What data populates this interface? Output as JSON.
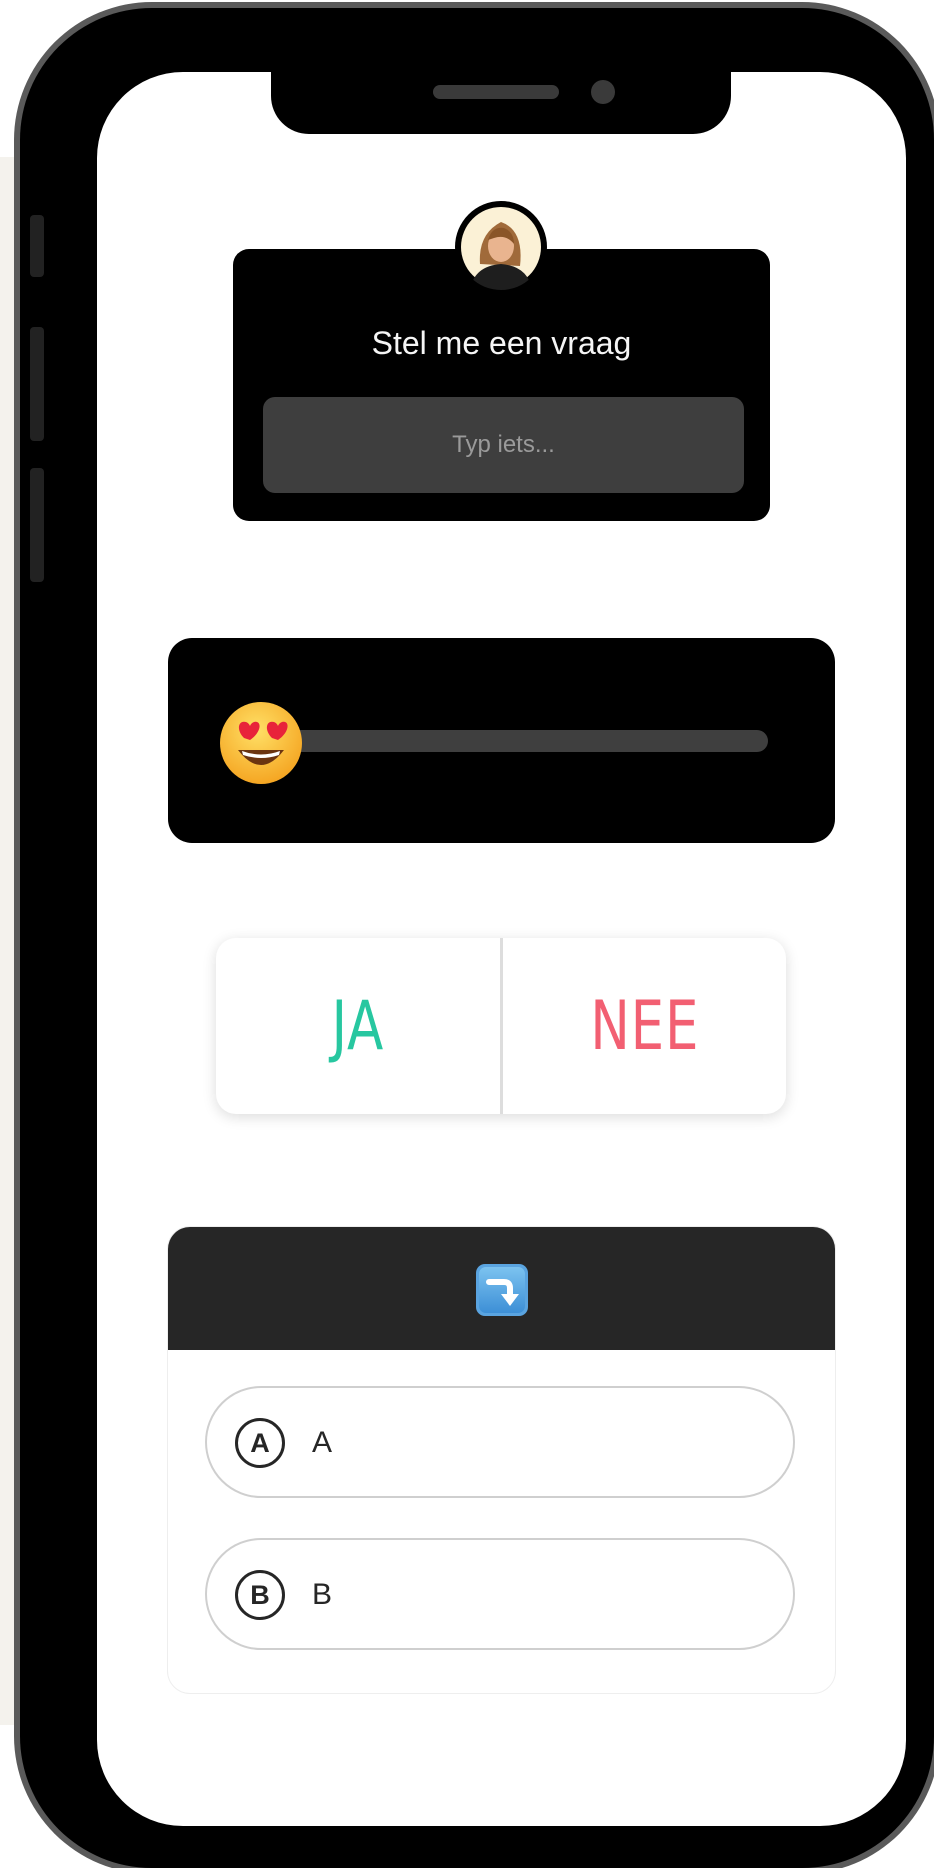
{
  "question_sticker": {
    "title": "Stel me een vraag",
    "placeholder": "Typ iets..."
  },
  "slider_sticker": {
    "emoji": "heart-eyes-emoji",
    "value": 0
  },
  "poll_sticker": {
    "option_yes": "JA",
    "option_no": "NEE",
    "colors": {
      "yes": "#27c7a0",
      "no": "#f25f72"
    }
  },
  "quiz_sticker": {
    "header_icon": "arrow-right-hook-down-icon",
    "answers": [
      {
        "letter": "A",
        "text": "A"
      },
      {
        "letter": "B",
        "text": "B"
      }
    ]
  }
}
